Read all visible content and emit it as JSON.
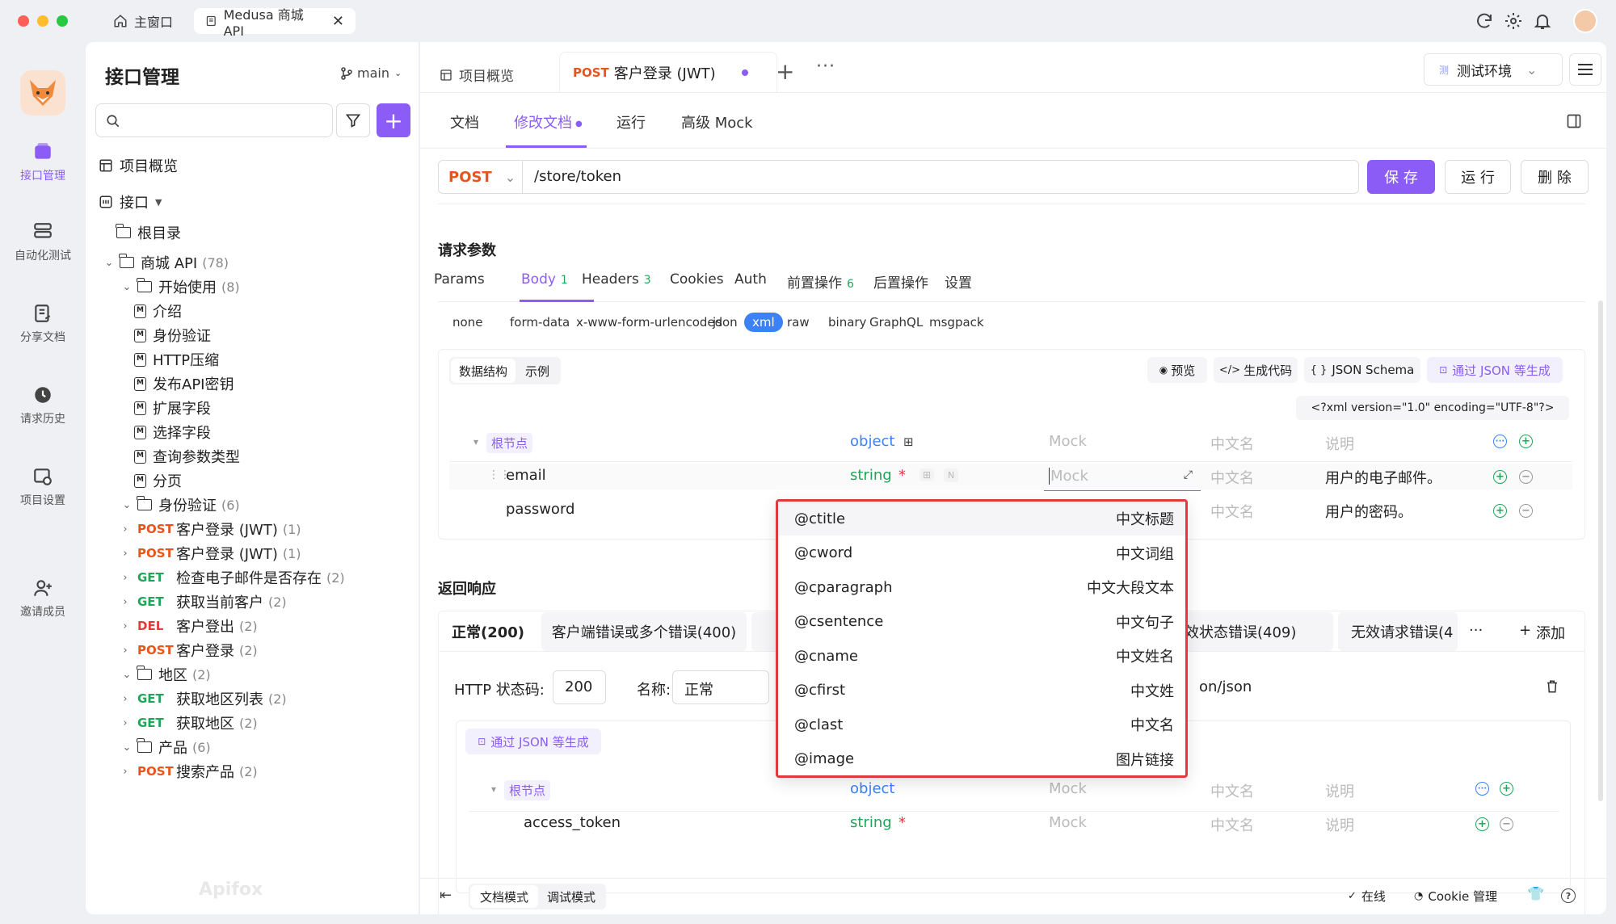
{
  "window": {
    "home_tab": "主窗口",
    "doc_tab": "Medusa 商城 API"
  },
  "rail": {
    "items": [
      "接口管理",
      "自动化测试",
      "分享文档",
      "请求历史",
      "项目设置"
    ],
    "invite": "邀请成员"
  },
  "sidebar": {
    "title": "接口管理",
    "branch": "main",
    "overview": "项目概览",
    "api_root": "接口",
    "root_dir": "根目录",
    "tree": [
      {
        "kind": "folder",
        "label": "商城 API",
        "count": "(78)",
        "level": 1,
        "chev": "v"
      },
      {
        "kind": "folder",
        "label": "开始使用",
        "count": "(8)",
        "level": 2,
        "chev": "v"
      },
      {
        "kind": "doc",
        "label": "介绍",
        "level": 3
      },
      {
        "kind": "doc",
        "label": "身份验证",
        "level": 3
      },
      {
        "kind": "doc",
        "label": "HTTP压缩",
        "level": 3
      },
      {
        "kind": "doc",
        "label": "发布API密钥",
        "level": 3
      },
      {
        "kind": "doc",
        "label": "扩展字段",
        "level": 3
      },
      {
        "kind": "doc",
        "label": "选择字段",
        "level": 3
      },
      {
        "kind": "doc",
        "label": "查询参数类型",
        "level": 3
      },
      {
        "kind": "doc",
        "label": "分页",
        "level": 3
      },
      {
        "kind": "folder",
        "label": "身份验证",
        "count": "(6)",
        "level": 2,
        "chev": "v"
      },
      {
        "kind": "api",
        "method": "POST",
        "label": "客户登录 (JWT)",
        "count": "(1)",
        "level": 3,
        "selected": true
      },
      {
        "kind": "api",
        "method": "POST",
        "label": "客户登录 (JWT)",
        "count": "(1)",
        "level": 3
      },
      {
        "kind": "api",
        "method": "GET",
        "label": "检查电子邮件是否存在",
        "count": "(2)",
        "level": 3
      },
      {
        "kind": "api",
        "method": "GET",
        "label": "获取当前客户",
        "count": "(2)",
        "level": 3
      },
      {
        "kind": "api",
        "method": "DEL",
        "label": "客户登出",
        "count": "(2)",
        "level": 3
      },
      {
        "kind": "api",
        "method": "POST",
        "label": "客户登录",
        "count": "(2)",
        "level": 3
      },
      {
        "kind": "folder",
        "label": "地区",
        "count": "(2)",
        "level": 2,
        "chev": "v"
      },
      {
        "kind": "api",
        "method": "GET",
        "label": "获取地区列表",
        "count": "(2)",
        "level": 3
      },
      {
        "kind": "api",
        "method": "GET",
        "label": "获取地区",
        "count": "(2)",
        "level": 3
      },
      {
        "kind": "folder",
        "label": "产品",
        "count": "(6)",
        "level": 2,
        "chev": "v"
      },
      {
        "kind": "api",
        "method": "POST",
        "label": "搜索产品",
        "count": "(2)",
        "level": 3
      }
    ],
    "watermark": "Apifox"
  },
  "tabs": {
    "overview": "项目概览",
    "active_method": "POST",
    "active_title": "客户登录 (JWT)",
    "env": "测试环境",
    "env_badge": "测"
  },
  "doc_tabs": [
    "文档",
    "修改文档",
    "运行",
    "高级 Mock"
  ],
  "request": {
    "method": "POST",
    "path": "/store/token",
    "save": "保 存",
    "run": "运 行",
    "delete": "删 除"
  },
  "params": {
    "section_title": "请求参数",
    "tabs": [
      {
        "label": "Params",
        "badge": ""
      },
      {
        "label": "Body",
        "badge": "1"
      },
      {
        "label": "Headers",
        "badge": "3"
      },
      {
        "label": "Cookies",
        "badge": ""
      },
      {
        "label": "Auth",
        "badge": ""
      },
      {
        "label": "前置操作",
        "badge": "6"
      },
      {
        "label": "后置操作",
        "badge": ""
      },
      {
        "label": "设置",
        "badge": ""
      }
    ],
    "body_types": [
      "none",
      "form-data",
      "x-www-form-urlencoded",
      "json",
      "xml",
      "raw",
      "binary",
      "GraphQL",
      "msgpack"
    ],
    "active_body": "xml",
    "struct_tab": "数据结构",
    "example_tab": "示例",
    "preview": "预览",
    "gen_code": "生成代码",
    "json_schema": "JSON Schema",
    "gen_from_json": "通过 JSON 等生成",
    "xml_decl": "<?xml version=\"1.0\" encoding=\"UTF-8\"?>",
    "rows": [
      {
        "name": "根节点",
        "type": "object",
        "mock": "Mock",
        "cn": "中文名",
        "desc": "说明"
      },
      {
        "name": "email",
        "type": "string",
        "mock": "Mock",
        "cn": "中文名",
        "desc": "用户的电子邮件。"
      },
      {
        "name": "password",
        "type": "",
        "mock": "",
        "cn": "中文名",
        "desc": "用户的密码。"
      }
    ]
  },
  "mock_dropdown": [
    {
      "key": "@ctitle",
      "label": "中文标题"
    },
    {
      "key": "@cword",
      "label": "中文词组"
    },
    {
      "key": "@cparagraph",
      "label": "中文大段文本"
    },
    {
      "key": "@csentence",
      "label": "中文句子"
    },
    {
      "key": "@cname",
      "label": "中文姓名"
    },
    {
      "key": "@cfirst",
      "label": "中文姓"
    },
    {
      "key": "@clast",
      "label": "中文名"
    },
    {
      "key": "@image",
      "label": "图片链接"
    }
  ],
  "response": {
    "section_title": "返回响应",
    "tabs": [
      "正常(200)",
      "客户端错误或多个错误(400)",
      "效状态错误(409)",
      "无效请求错误(4"
    ],
    "add": "添加",
    "status_label": "HTTP 状态码:",
    "status_value": "200",
    "name_label": "名称:",
    "name_value": "正常",
    "content_type": "on/json",
    "gen_from_json": "通过 JSON 等生成",
    "rows": [
      {
        "name": "根节点",
        "type": "object",
        "mock": "Mock",
        "cn": "中文名",
        "desc": "说明"
      },
      {
        "name": "access_token",
        "type": "string",
        "mock": "Mock",
        "cn": "中文名",
        "desc": "说明"
      }
    ]
  },
  "footer": {
    "doc_mode": "文档模式",
    "debug_mode": "调试模式",
    "online": "在线",
    "cookie": "Cookie 管理"
  },
  "colors": {
    "accent": "#8b5cf6",
    "post": "#e8541e",
    "get": "#21a55a",
    "del": "#e03c3c",
    "highlight": "#e23a3a"
  }
}
